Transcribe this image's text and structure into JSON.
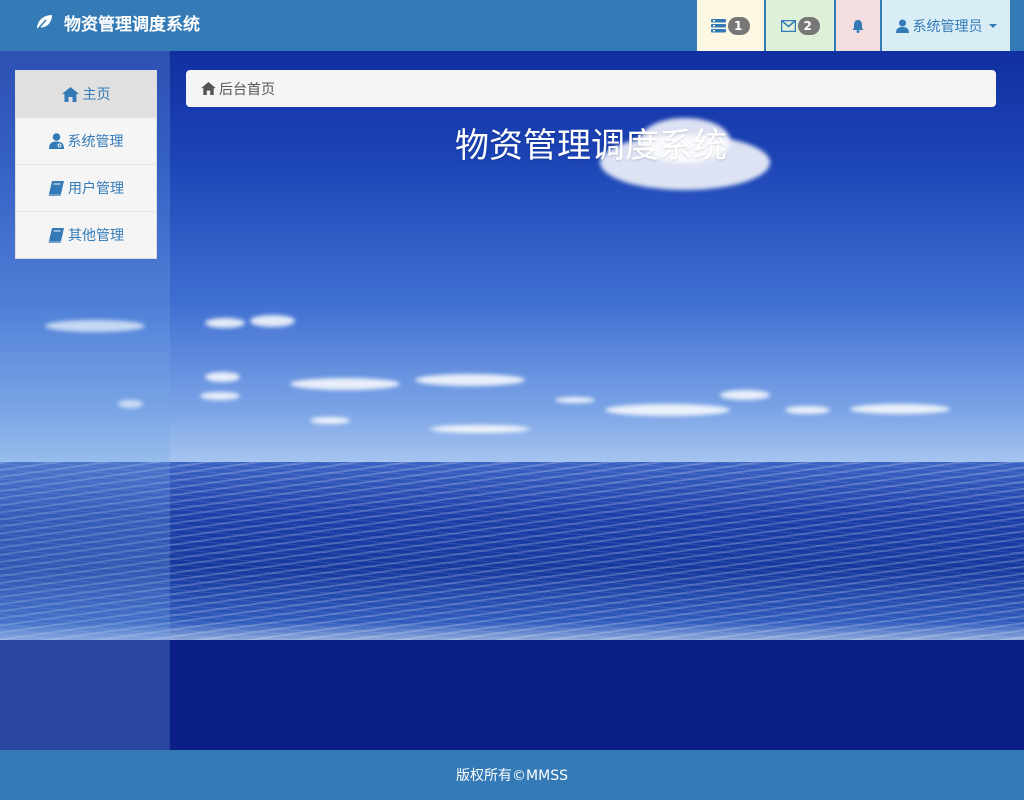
{
  "navbar": {
    "brand": "物资管理调度系统",
    "tasks_badge": "1",
    "messages_badge": "2",
    "user_label": "系统管理员"
  },
  "sidebar": {
    "items": [
      {
        "label": "主页",
        "icon": "home-icon",
        "active": true
      },
      {
        "label": "系统管理",
        "icon": "user-admin-icon"
      },
      {
        "label": "用户管理",
        "icon": "book-icon"
      },
      {
        "label": "其他管理",
        "icon": "book-icon"
      }
    ]
  },
  "breadcrumb": {
    "label": "后台首页",
    "icon": "home-icon"
  },
  "main": {
    "title": "物资管理调度系统"
  },
  "footer": {
    "text": "版权所有©MMSS"
  },
  "colors": {
    "primary": "#337ab7",
    "tile_warning": "#fcf8e3",
    "tile_success": "#dff0d8",
    "tile_danger": "#f2dede",
    "tile_info": "#d9edf7"
  }
}
